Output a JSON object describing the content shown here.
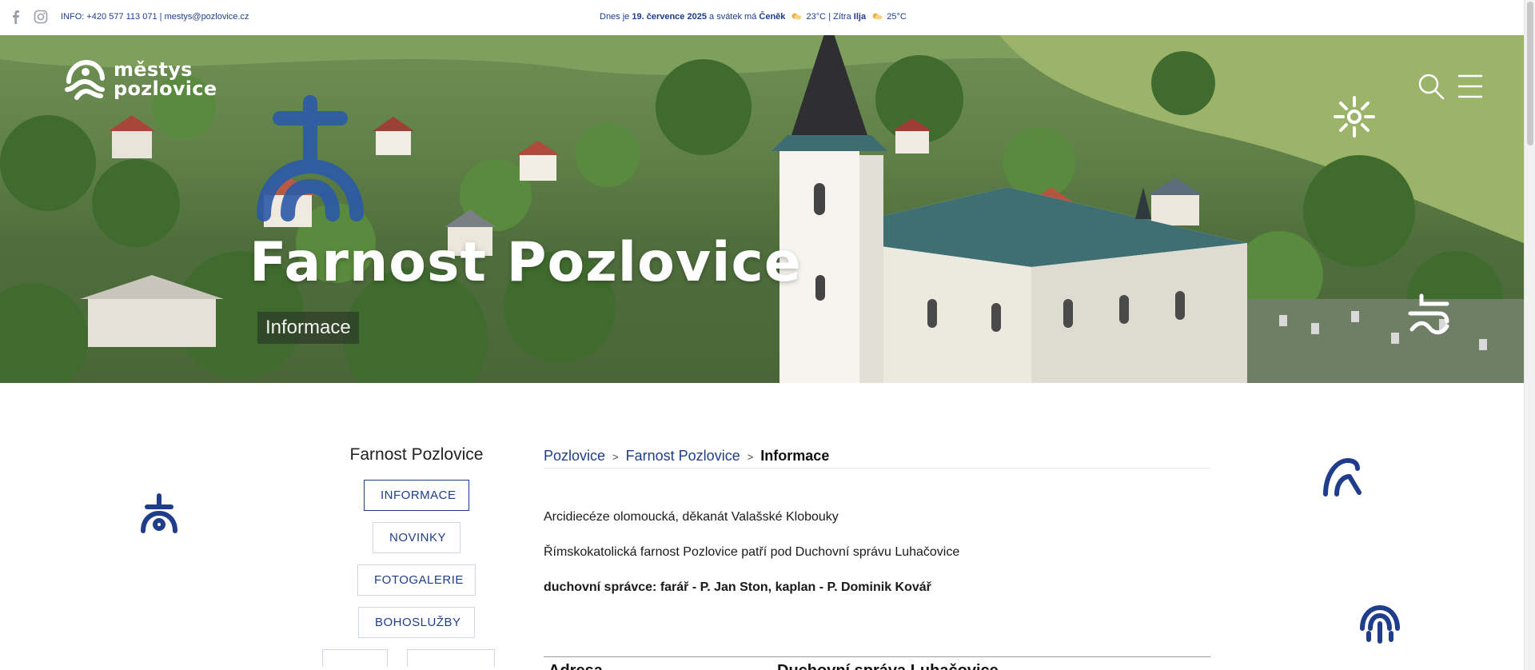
{
  "topbar": {
    "social": [
      "facebook-icon",
      "instagram-icon"
    ],
    "info_label": "INFO: +420 577 113 071",
    "separator": "|",
    "email": "mestys@pozlovice.cz",
    "today_prefix": "Dnes je",
    "today_date": "19. července 2025",
    "today_mid": "a svátek má",
    "today_name": "Čeněk",
    "today_temp": "23°C",
    "tomorrow_prefix": "| Zítra",
    "tomorrow_name": "Ilja",
    "tomorrow_temp": "25°C",
    "weather_icon": "partly-sunny-icon"
  },
  "brand": {
    "line1": "městys",
    "line2": "pozlovice",
    "accent": "#1f3d8a"
  },
  "hero": {
    "title": "Farnost Pozlovice",
    "subtitle": "Informace",
    "icons": [
      "search-icon",
      "menu-icon"
    ]
  },
  "sidebar": {
    "title": "Farnost Pozlovice",
    "items": [
      {
        "label": "INFORMACE",
        "active": true
      },
      {
        "label": "NOVINKY",
        "active": false
      },
      {
        "label": "FOTOGALERIE",
        "active": false
      },
      {
        "label": "BOHOSLUŽBY",
        "active": false
      }
    ]
  },
  "breadcrumb": {
    "items": [
      "Pozlovice",
      "Farnost Pozlovice"
    ],
    "separator": ">",
    "current": "Informace"
  },
  "content": {
    "line1": "Arcidiecéze olomoucká, děkanát Valašské Klobouky",
    "line2": "Římskokatolická farnost Pozlovice patří pod Duchovní správu Luhačovice",
    "line3": "duchovní správce: farář - P. Jan Ston, kaplan - P. Dominik Kovář",
    "cut_left": "Adresa",
    "cut_right": "Duchovní správa Luhačovice"
  }
}
